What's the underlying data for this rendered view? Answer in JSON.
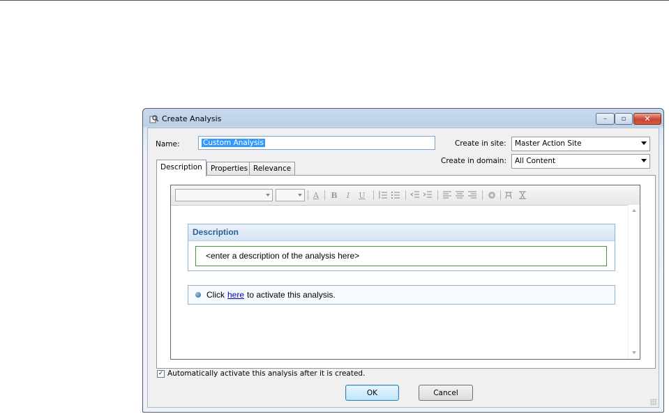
{
  "window": {
    "title": "Create Analysis",
    "controls": {
      "minimize": "–",
      "maximize": "▫",
      "close": "✕"
    }
  },
  "form": {
    "name_label": "Name:",
    "name_value": "Custom Analysis",
    "site_label": "Create in site:",
    "site_value": "Master Action Site",
    "domain_label": "Create in domain:",
    "domain_value": "All Content"
  },
  "tabs": [
    {
      "label": "Description",
      "active": true
    },
    {
      "label": "Properties",
      "active": false
    },
    {
      "label": "Relevance",
      "active": false
    }
  ],
  "editor": {
    "toolbar": {
      "icons": [
        "font-color-icon",
        "bold-icon",
        "italic-icon",
        "underline-icon",
        "ordered-list-icon",
        "unordered-list-icon",
        "outdent-icon",
        "indent-icon",
        "align-left-icon",
        "align-center-icon",
        "align-right-icon",
        "insert-image-icon",
        "spellcheck-icon",
        "clear-format-icon"
      ],
      "glyphs": {
        "font_color": "A",
        "bold": "B",
        "italic": "I",
        "underline": "U"
      }
    },
    "description_heading": "Description",
    "description_placeholder": "<enter a description of the analysis here>",
    "activate_prefix": "Click",
    "activate_link": "here",
    "activate_suffix": "to activate this analysis."
  },
  "footer": {
    "auto_activate_label": "Automatically activate this analysis after it is created.",
    "auto_activate_checked": true,
    "ok_label": "OK",
    "cancel_label": "Cancel"
  }
}
